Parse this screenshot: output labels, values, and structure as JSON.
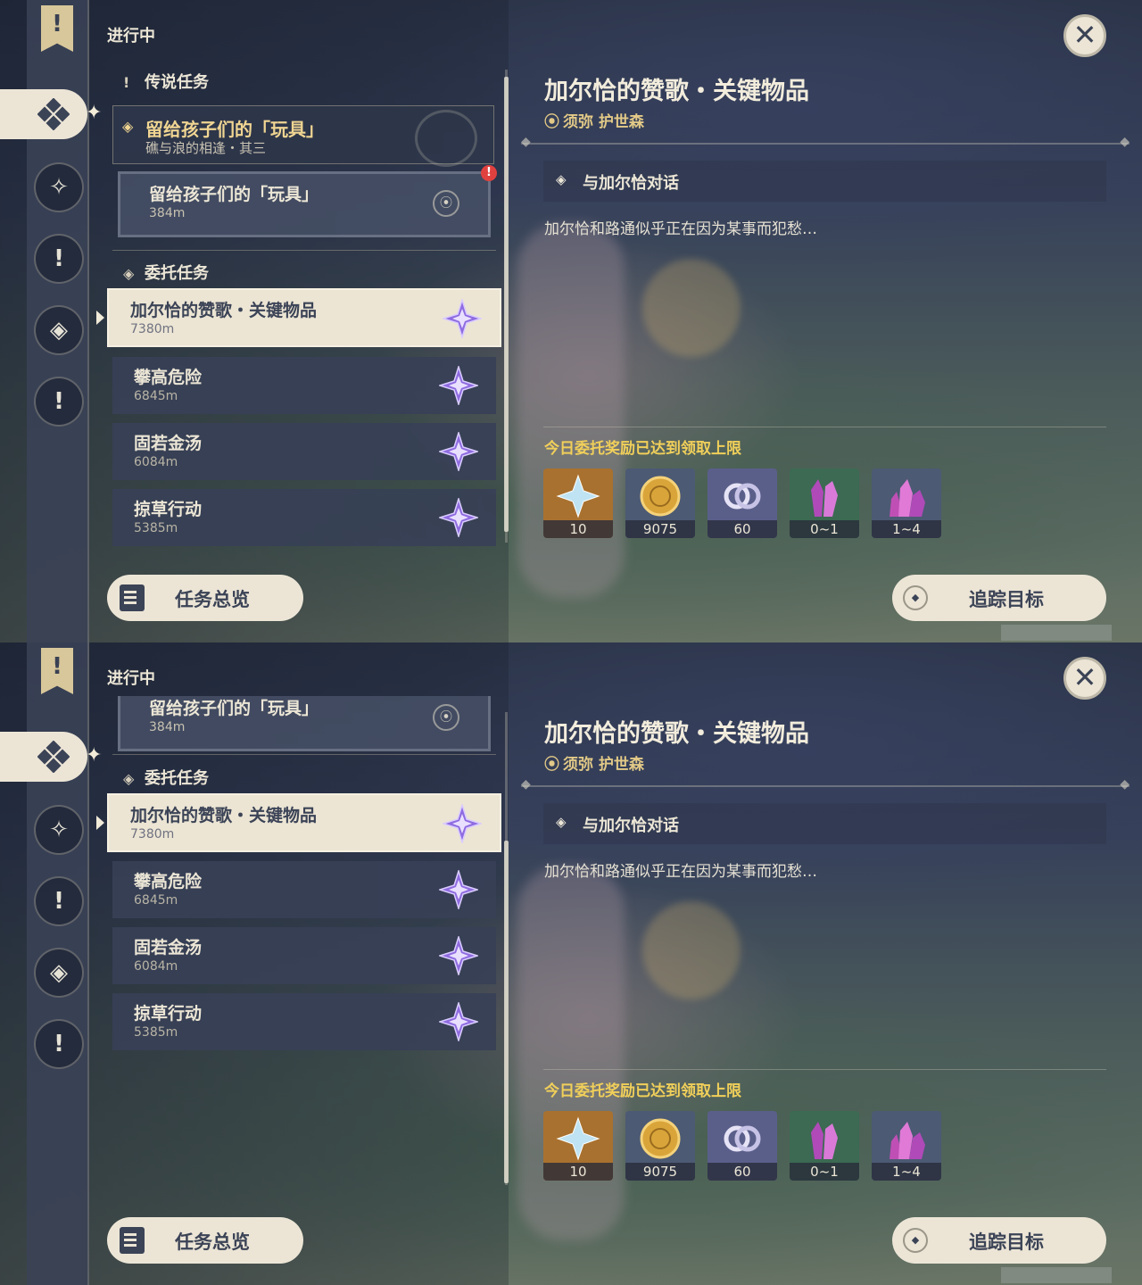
{
  "header": {
    "section": "进行中",
    "close_icon": "close-icon"
  },
  "sidebar": {
    "icons": [
      "banner-icon",
      "commission-icon",
      "archon-quest-icon",
      "story-quest-icon",
      "world-quest-icon",
      "exclamation-icon"
    ]
  },
  "legend_section": {
    "label": "传说任务",
    "quest_title": "留给孩子们的「玩具」",
    "quest_sub": "礁与浪的相逢・其三",
    "subtask_title": "留给孩子们的「玩具」",
    "subtask_dist": "384m"
  },
  "commission_section": {
    "label": "委托任务",
    "quests": [
      {
        "title": "加尔恰的赞歌・关键物品",
        "dist": "7380m"
      },
      {
        "title": "攀高危险",
        "dist": "6845m"
      },
      {
        "title": "固若金汤",
        "dist": "6084m"
      },
      {
        "title": "掠草行动",
        "dist": "5385m"
      }
    ]
  },
  "detail": {
    "title": "加尔恰的赞歌・关键物品",
    "location": "须弥 护世森",
    "objective": "与加尔恰对话",
    "description": "加尔恰和路通似乎正在因为某事而犯愁…",
    "reward_note": "今日委托奖励已达到领取上限",
    "rewards": [
      {
        "name": "primogem",
        "count": "10",
        "bg": "#a9712f"
      },
      {
        "name": "mora",
        "count": "9075",
        "bg": "#4c5a74"
      },
      {
        "name": "companionship-exp",
        "count": "60",
        "bg": "#5a5f8a"
      },
      {
        "name": "crystal-chunk-small",
        "count": "0~1",
        "bg": "#3c6a52"
      },
      {
        "name": "crystal-chunk",
        "count": "1~4",
        "bg": "#4c5a74"
      }
    ]
  },
  "buttons": {
    "overview": "任务总览",
    "track": "追踪目标"
  },
  "colors": {
    "accent_gold": "#f0cf5a",
    "card_cream": "#ece5d6",
    "quest_purple": "#8f6be0"
  }
}
